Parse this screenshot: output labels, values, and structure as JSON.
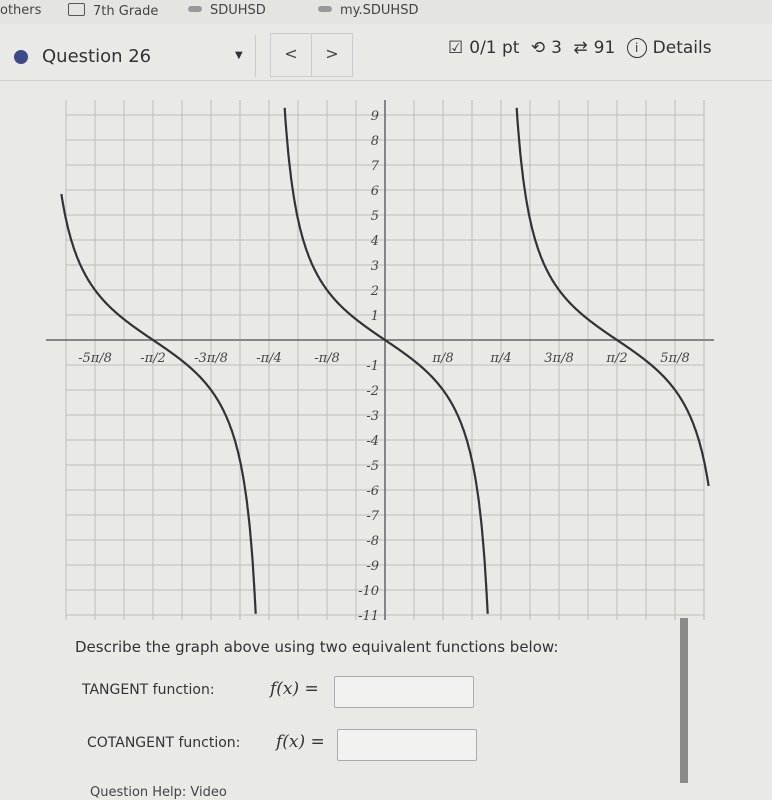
{
  "bookmarks": [
    {
      "label": "others",
      "icon": "none"
    },
    {
      "label": "7th Grade",
      "icon": "folder-icon"
    },
    {
      "label": "SDUHSD",
      "icon": "cloud-icon"
    },
    {
      "label": "my.SDUHSD",
      "icon": "cloud-icon"
    }
  ],
  "question": {
    "title": "Question 26",
    "score": "0/1 pt",
    "retries": "3",
    "attempts": "91",
    "details_label": "Details",
    "prev_label": "<",
    "next_label": ">",
    "status_color": "#3d4a8a"
  },
  "chart_data": {
    "type": "line",
    "title": "",
    "xlabel": "",
    "ylabel": "",
    "x_tick_labels": [
      "-5π/8",
      "-π/2",
      "-3π/8",
      "-π/4",
      "-π/8",
      "π/8",
      "π/4",
      "3π/8",
      "π/2",
      "5π/8"
    ],
    "y_tick_labels": [
      "9",
      "8",
      "7",
      "6",
      "5",
      "4",
      "3",
      "2",
      "1",
      "-1",
      "-2",
      "-3",
      "-4",
      "-5",
      "-6",
      "-7",
      "-8",
      "-9",
      "-10",
      "-11"
    ],
    "ylim": [
      -11,
      9
    ],
    "xlim": [
      "-11π/16",
      "11π/16"
    ],
    "grid": true,
    "asymptotes": [
      "-3π/4",
      "-π/4",
      "π/4",
      "3π/4"
    ],
    "zeros": [
      "-π/2",
      "0",
      "π/2"
    ],
    "period": "π/2",
    "series": [
      {
        "x": [
          "-5π/8",
          "-π/2",
          "-3π/8",
          "-π/8",
          "0",
          "π/8",
          "3π/8",
          "π/2",
          "5π/8"
        ],
        "y": [
          2,
          0,
          -2,
          2,
          0,
          -2,
          2,
          0,
          -2
        ]
      }
    ]
  },
  "prompt": "Describe the graph above using two equivalent functions below:",
  "answers": [
    {
      "label": "TANGENT function:",
      "fx": "f(x) =",
      "value": ""
    },
    {
      "label": "COTANGENT function:",
      "fx": "f(x) =",
      "value": ""
    }
  ],
  "help": "Question Help:  Video"
}
